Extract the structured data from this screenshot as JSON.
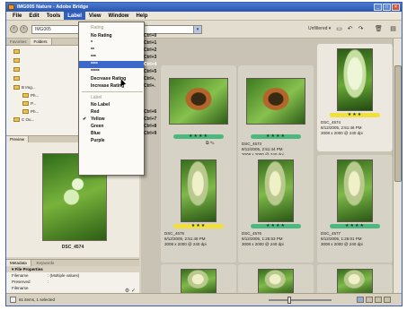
{
  "window": {
    "title": "IMG005 Nature - Adobe Bridge",
    "min": "_",
    "max": "□",
    "close": "×"
  },
  "menubar": [
    "File",
    "Edit",
    "Tools",
    "Label",
    "View",
    "Window",
    "Help"
  ],
  "toolbar": {
    "path": "IMG005",
    "unfiltered": "Unfiltered ▾"
  },
  "left_tabs": {
    "favorites": "Favorites",
    "folders": "Folders"
  },
  "folder_tree": [
    "B Img...",
    "Ph...",
    "P...",
    "Ph...",
    "C Ou..."
  ],
  "preview": {
    "tab": "Preview",
    "caption": "DSC_4574"
  },
  "metadata": {
    "tabs": [
      "Metadata",
      "Keywords"
    ],
    "section": "File Properties",
    "rows": [
      {
        "key": "Filename",
        "value": ": (Multiple values)"
      },
      {
        "key": "Preserved Filename",
        "value": ":"
      }
    ]
  },
  "status": {
    "text": "61 items, 1 selected",
    "slider_value": 0.32
  },
  "label_menu": {
    "rating_header": "Rating",
    "label_header": "Label",
    "items": [
      {
        "label": "No Rating",
        "shortcut": "Ctrl+0"
      },
      {
        "label": "*",
        "shortcut": "Ctrl+1"
      },
      {
        "label": "**",
        "shortcut": "Ctrl+2"
      },
      {
        "label": "***",
        "shortcut": "Ctrl+3"
      },
      {
        "label": "****",
        "shortcut": "Ctrl+4"
      },
      {
        "label": "*****",
        "shortcut": "Ctrl+5"
      },
      {
        "label": "Decrease Rating",
        "shortcut": "Ctrl+,"
      },
      {
        "label": "Increase Rating",
        "shortcut": "Ctrl+."
      },
      {
        "label": "No Label",
        "shortcut": ""
      },
      {
        "label": "Red",
        "shortcut": "Ctrl+6"
      },
      {
        "label": "Yellow",
        "shortcut": "Ctrl+7"
      },
      {
        "label": "Green",
        "shortcut": "Ctrl+8"
      },
      {
        "label": "Blue",
        "shortcut": "Ctrl+9"
      },
      {
        "label": "Purple",
        "shortcut": ""
      }
    ],
    "checked": "✔"
  },
  "thumbnails": [
    {
      "name": "",
      "date": "8/12/2005, 2:51:40 PM",
      "dims": "3008 x 2000 @ 240 dpi",
      "rating": "★★★★",
      "label_color": "green",
      "selected": false
    },
    {
      "name": "DSC_4573",
      "date": "8/12/2005, 2:51:44 PM",
      "dims": "3008 x 2000 @ 240 dpi",
      "rating": "★★★★",
      "label_color": "green",
      "selected": false
    },
    {
      "name": "DSC_4574",
      "date": "8/12/2005, 2:51:46 PM",
      "dims": "3008 x 2000 @ 240 dpi",
      "rating": "★★★",
      "label_color": "yellow",
      "selected": true
    },
    {
      "name": "DSC_4575",
      "date": "8/12/2005, 2:51:48 PM",
      "dims": "3008 x 2000 @ 240 dpi",
      "rating": "★★★",
      "label_color": "yellow",
      "selected": false
    },
    {
      "name": "DSC_4576",
      "date": "8/12/2005, 1:25:53 PM",
      "dims": "3008 x 2000 @ 240 dpi",
      "rating": "★★★★",
      "label_color": "green",
      "selected": false
    },
    {
      "name": "DSC_4577",
      "date": "8/12/2005, 1:26:01 PM",
      "dims": "3008 x 2000 @ 240 dpi",
      "rating": "★★★★",
      "label_color": "green",
      "selected": false
    }
  ],
  "colors": {
    "menu_highlight": "#3c69c9",
    "green_label": "#4bb97f",
    "yellow_label": "#f1df3a",
    "title_bar": "#2a55b0"
  }
}
